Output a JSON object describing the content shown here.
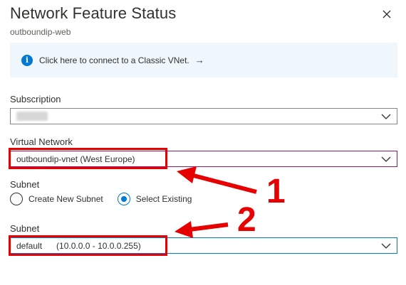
{
  "header": {
    "title": "Network Feature Status",
    "subtitle": "outboundip-web"
  },
  "info_banner": {
    "text": "Click here to connect to a Classic VNet.",
    "arrow": "→"
  },
  "subscription": {
    "label": "Subscription",
    "value": "",
    "value_obscured": true
  },
  "virtual_network": {
    "label": "Virtual Network",
    "value": "outboundip-vnet (West Europe)"
  },
  "subnet_mode": {
    "label": "Subnet",
    "options": [
      {
        "label": "Create New Subnet",
        "selected": false
      },
      {
        "label": "Select Existing",
        "selected": true
      }
    ]
  },
  "subnet": {
    "label": "Subnet",
    "name": "default",
    "range": "(10.0.0.0 - 10.0.0.255)"
  },
  "annotations": {
    "marker_1": "1",
    "marker_2": "2",
    "color": "#e60000"
  },
  "colors": {
    "accent": "#0078d4",
    "banner_bg": "#eff6fc",
    "vnet_border": "#8a1c6f"
  }
}
